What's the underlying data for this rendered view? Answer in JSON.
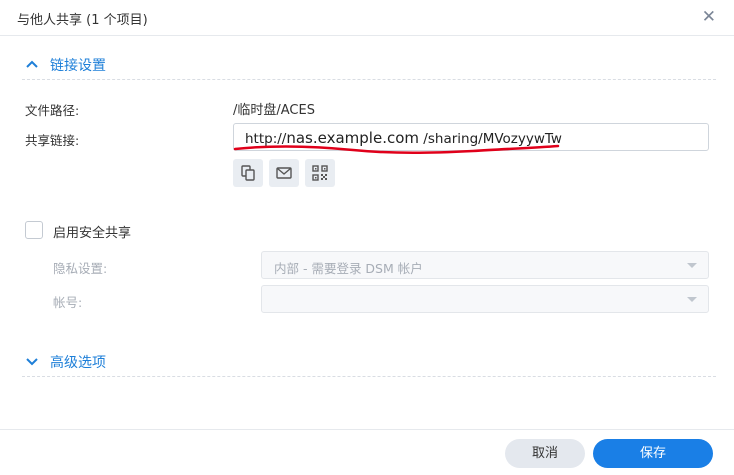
{
  "dialog": {
    "title": "与他人共享 (1 个项目)",
    "close_icon": "close-icon"
  },
  "link_section": {
    "title": "链接设置",
    "path_label": "文件路径:",
    "path_value": "/临时盘/ACES",
    "share_link_label": "共享链接:",
    "share_link": {
      "prefix": "http://",
      "host": "nas.example.com",
      "path": " /sharing/MVozyywTw"
    },
    "actions": [
      {
        "name": "copy-icon"
      },
      {
        "name": "mail-icon"
      },
      {
        "name": "qr-code-icon"
      }
    ]
  },
  "secure_share": {
    "checkbox_label": "启用安全共享",
    "checked": false,
    "privacy_label": "隐私设置:",
    "privacy_value": "内部 - 需要登录 DSM 帐户",
    "account_label": "帐号:",
    "account_value": ""
  },
  "advanced_section": {
    "title": "高级选项"
  },
  "footer": {
    "cancel_label": "取消",
    "save_label": "保存"
  },
  "colors": {
    "accent": "#1a7fe6",
    "section_title": "#1e7fd8",
    "annotation_red": "#e0001a"
  }
}
